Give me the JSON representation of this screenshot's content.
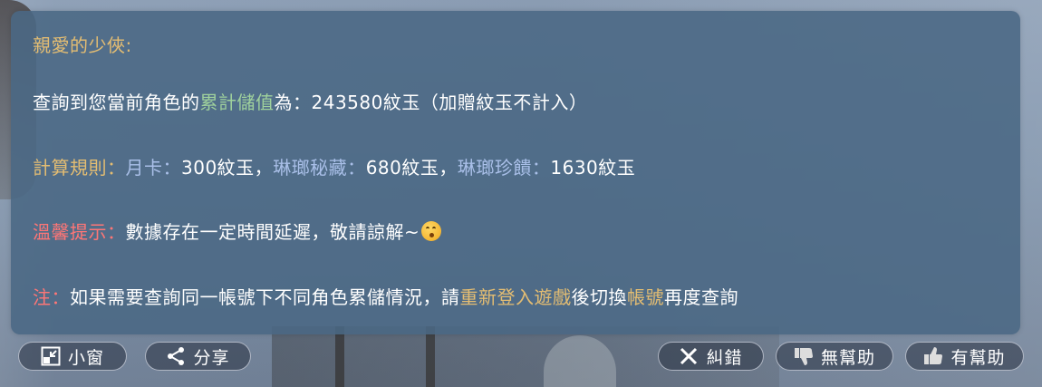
{
  "message": {
    "greeting": "親愛的少俠:",
    "line2": {
      "prefix": "查詢到您當前角色的",
      "highlight": "累計儲值",
      "suffix": "為：243580紋玉（加贈紋玉不計入）"
    },
    "line3": {
      "label": "計算規則：",
      "item1_name": "月卡：",
      "item1_value": "300紋玉，",
      "item2_name": "琳瑯秘藏：",
      "item2_value": "680紋玉，",
      "item3_name": "琳瑯珍饋：",
      "item3_value": "1630紋玉"
    },
    "line4": {
      "label": "溫馨提示：",
      "text": "數據存在一定時間延遲，敬請諒解~"
    },
    "line5": {
      "label": "注：",
      "text1": "如果需要查詢同一帳號下不同角色累儲情況，請",
      "highlight1": "重新登入遊戲",
      "text2": "後切換",
      "highlight2": "帳號",
      "text3": "再度查詢"
    }
  },
  "toolbar": {
    "mini_window_label": "小窗",
    "share_label": "分享",
    "report_error_label": "糾錯",
    "not_helpful_label": "無幫助",
    "helpful_label": "有幫助"
  },
  "icons": {
    "mini_window": "mini-window-icon",
    "share": "share-icon",
    "report_error": "close-x-icon",
    "not_helpful": "thumbs-down-icon",
    "helpful": "thumbs-up-icon",
    "emoji": "kissing-face-emoji"
  },
  "colors": {
    "panel_bg": "#4a6884",
    "gold": "#e4bd72",
    "green": "#9fd19c",
    "blue": "#a9bfe8",
    "red": "#ff7676"
  }
}
